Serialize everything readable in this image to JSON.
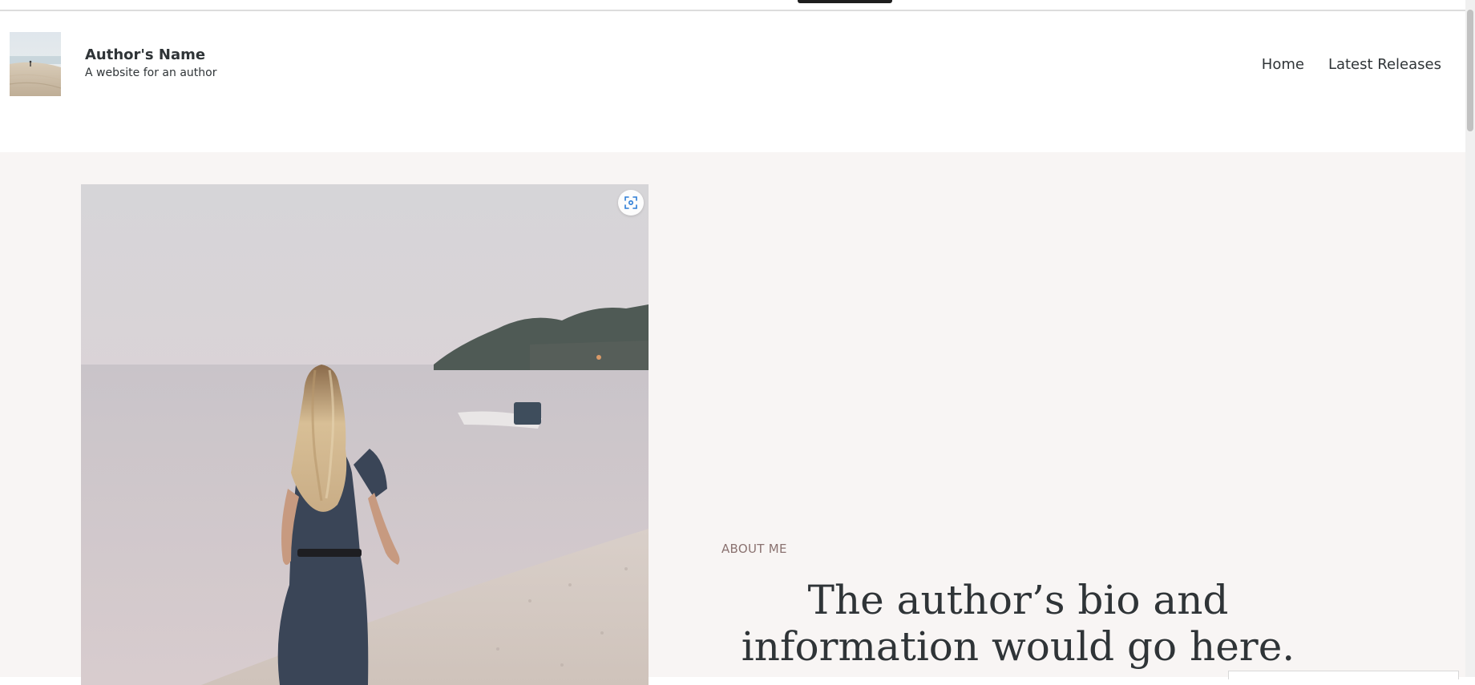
{
  "site": {
    "title": "Author's Name",
    "tagline": "A website for an author"
  },
  "nav": {
    "items": [
      {
        "label": "Home"
      },
      {
        "label": "Latest Releases"
      }
    ]
  },
  "hero": {
    "section_label": "ABOUT ME",
    "heading": "The author’s bio and information would go here."
  },
  "colors": {
    "text": "#2f3437",
    "accent_label": "#8a7270",
    "section_bg": "#f8f5f4",
    "zoom_icon": "#2c7cd6"
  },
  "icons": {
    "zoom": "zoom-expand-icon"
  }
}
